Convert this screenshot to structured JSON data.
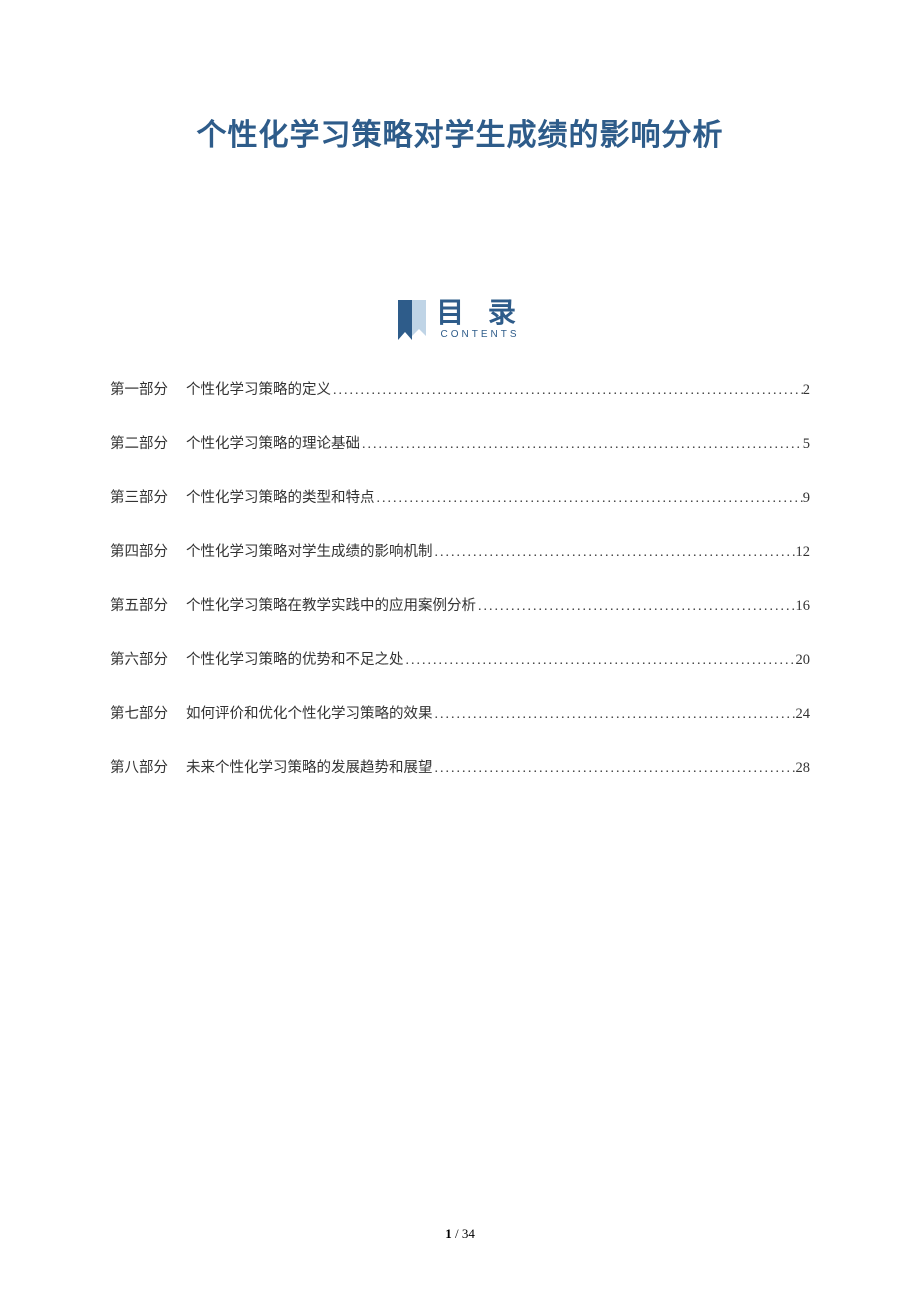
{
  "title": "个性化学习策略对学生成绩的影响分析",
  "toc": {
    "heading": "目 录",
    "subheading": "CONTENTS",
    "items": [
      {
        "part": "第一部分",
        "text": "个性化学习策略的定义",
        "page": "2"
      },
      {
        "part": "第二部分",
        "text": "个性化学习策略的理论基础",
        "page": "5"
      },
      {
        "part": "第三部分",
        "text": "个性化学习策略的类型和特点",
        "page": "9"
      },
      {
        "part": "第四部分",
        "text": "个性化学习策略对学生成绩的影响机制",
        "page": "12"
      },
      {
        "part": "第五部分",
        "text": "个性化学习策略在教学实践中的应用案例分析",
        "page": "16"
      },
      {
        "part": "第六部分",
        "text": "个性化学习策略的优势和不足之处",
        "page": "20"
      },
      {
        "part": "第七部分",
        "text": "如何评价和优化个性化学习策略的效果",
        "page": "24"
      },
      {
        "part": "第八部分",
        "text": "未来个性化学习策略的发展趋势和展望",
        "page": "28"
      }
    ]
  },
  "footer": {
    "current": "1",
    "sep": " / ",
    "total": "34"
  }
}
